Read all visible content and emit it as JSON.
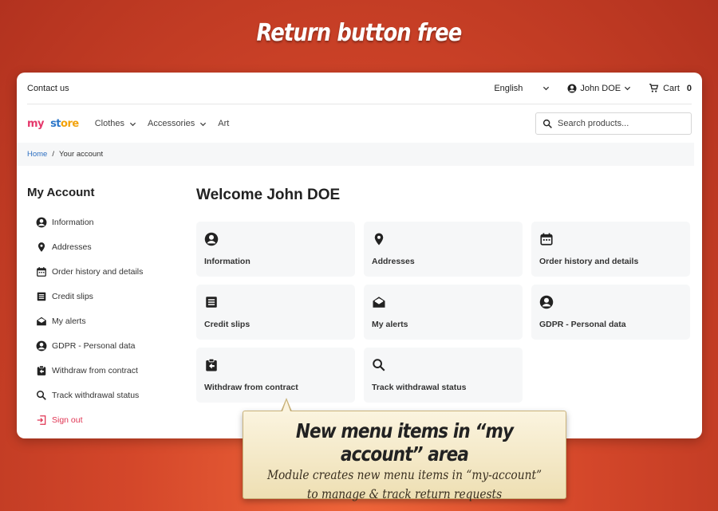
{
  "banner": {
    "title": "Return button free"
  },
  "header": {
    "contact": "Contact us",
    "language": "English",
    "user": "John DOE",
    "cart_label": "Cart",
    "cart_count": "0"
  },
  "nav": {
    "logo": [
      "my",
      "st",
      "ore"
    ],
    "items": [
      "Clothes",
      "Accessories",
      "Art"
    ],
    "search_placeholder": "Search products..."
  },
  "breadcrumb": {
    "home": "Home",
    "separator": "/",
    "current": "Your account"
  },
  "sidebar": {
    "title": "My Account",
    "items": [
      {
        "label": "Information",
        "icon": "account-circle-icon"
      },
      {
        "label": "Addresses",
        "icon": "location-pin-icon"
      },
      {
        "label": "Order history and details",
        "icon": "calendar-icon"
      },
      {
        "label": "Credit slips",
        "icon": "receipt-icon"
      },
      {
        "label": "My alerts",
        "icon": "mail-open-icon"
      },
      {
        "label": "GDPR - Personal data",
        "icon": "account-circle-icon"
      },
      {
        "label": "Withdraw from contract",
        "icon": "clipboard-return-icon"
      },
      {
        "label": "Track withdrawal status",
        "icon": "search-icon"
      },
      {
        "label": "Sign out",
        "icon": "logout-icon"
      }
    ]
  },
  "main": {
    "welcome": "Welcome John DOE",
    "cards": [
      {
        "label": "Information",
        "icon": "account-circle-icon"
      },
      {
        "label": "Addresses",
        "icon": "location-pin-icon"
      },
      {
        "label": "Order history and details",
        "icon": "calendar-icon"
      },
      {
        "label": "Credit slips",
        "icon": "receipt-icon"
      },
      {
        "label": "My alerts",
        "icon": "mail-open-icon"
      },
      {
        "label": "GDPR - Personal data",
        "icon": "account-circle-icon"
      },
      {
        "label": "Withdraw from contract",
        "icon": "clipboard-return-icon"
      },
      {
        "label": "Track withdrawal status",
        "icon": "search-icon"
      }
    ]
  },
  "callout": {
    "title": "New menu items in “my account” area",
    "line1": "Module creates new menu items in “my-account”",
    "line2": "to manage & track return requests"
  },
  "colors": {
    "accent_red": "#e03553",
    "link_blue": "#2d6fc1",
    "background": "#d4472a"
  }
}
